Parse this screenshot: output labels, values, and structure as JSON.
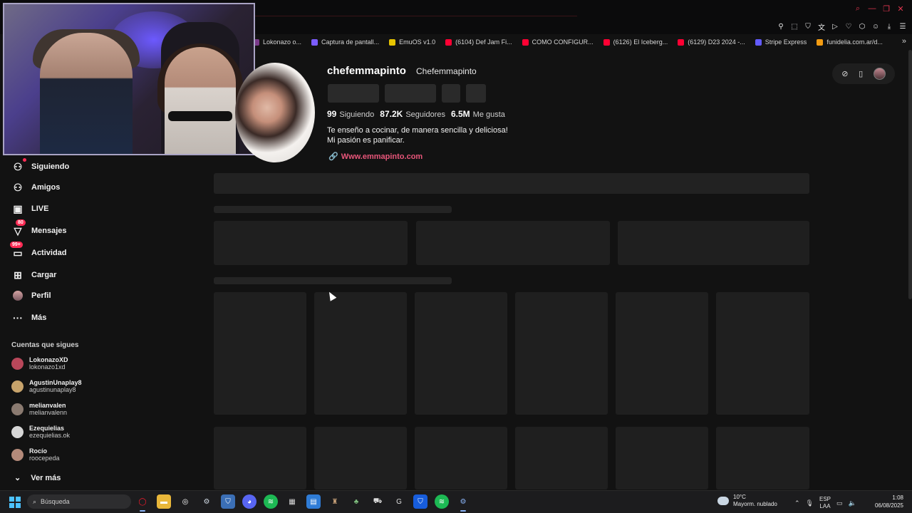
{
  "bookmarks": [
    {
      "label": "Lokonazo o...",
      "color": "#7a3a8a"
    },
    {
      "label": "Captura de pantall...",
      "color": "#7b5cff"
    },
    {
      "label": "EmuOS v1.0",
      "color": "#e6c400"
    },
    {
      "label": "(6104) Def Jam Fi...",
      "color": "#ff0033"
    },
    {
      "label": "COMO CONFIGUR...",
      "color": "#ff0033"
    },
    {
      "label": "(6126) El Iceberg...",
      "color": "#ff0033"
    },
    {
      "label": "(6129) D23 2024 -...",
      "color": "#ff0033"
    },
    {
      "label": "Stripe Express",
      "color": "#635bff"
    },
    {
      "label": "funidelia.com.ar/d...",
      "color": "#f39c12"
    }
  ],
  "sidebar": {
    "items": [
      {
        "label": "Siguiendo",
        "icon": "following-icon"
      },
      {
        "label": "Amigos",
        "icon": "friends-icon"
      },
      {
        "label": "LIVE",
        "icon": "live-icon"
      },
      {
        "label": "Mensajes",
        "icon": "messages-icon",
        "badge": "80"
      },
      {
        "label": "Actividad",
        "icon": "activity-icon",
        "badge": "99+"
      },
      {
        "label": "Cargar",
        "icon": "upload-icon"
      },
      {
        "label": "Perfil",
        "icon": "profile-icon"
      },
      {
        "label": "Más",
        "icon": "more-icon"
      }
    ],
    "following_title": "Cuentas que sigues",
    "accounts": [
      {
        "name": "LokonazoXD",
        "user": "lokonazo1xd",
        "color": "#b9475a"
      },
      {
        "name": "AgustinUnaplay8",
        "user": "agustinunaplay8",
        "color": "#c7a36b"
      },
      {
        "name": "melianvalen",
        "user": "melianvalenn",
        "color": "#8a7a70"
      },
      {
        "name": "Ezequielias",
        "user": "ezequielias.ok",
        "color": "#d6d6d6"
      },
      {
        "name": "Rocío",
        "user": "roocepeda",
        "color": "#b48a7a"
      }
    ],
    "see_more": "Ver más"
  },
  "profile": {
    "username": "chefemmapinto",
    "nickname": "Chefemmapinto",
    "following_count": "99",
    "following_label": "Siguiendo",
    "followers_count": "87.2K",
    "followers_label": "Seguidores",
    "likes_count": "6.5M",
    "likes_label": "Me gusta",
    "bio_line1": "Te enseño a cocinar, de manera sencilla y deliciosa!",
    "bio_line2": "Mi pasión es panificar.",
    "website": "Www.emmapinto.com"
  },
  "taskbar": {
    "search_placeholder": "Búsqueda",
    "weather_temp": "10°C",
    "weather_desc": "Mayorm. nublado",
    "lang_top": "ESP",
    "lang_bottom": "LAA",
    "time": "1:08",
    "date": "06/08/2025"
  }
}
